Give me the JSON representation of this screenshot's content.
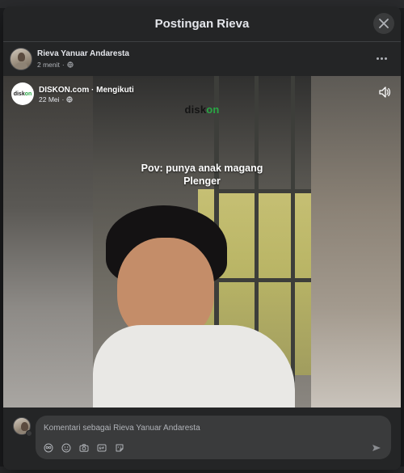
{
  "modal": {
    "title": "Postingan Rieva"
  },
  "post": {
    "author": "Rieva Yanuar Andaresta",
    "time": "2 menit",
    "separator": "·"
  },
  "video": {
    "page_name": "DISKON.com · Mengikuti",
    "page_logo_prefix": "disk",
    "page_logo_accent": "on",
    "date": "22 Mei",
    "separator": "·",
    "brand_prefix": "disk",
    "brand_accent": "on",
    "caption_line1": "Pov: punya anak magang",
    "caption_line2": "Plenger"
  },
  "comment": {
    "placeholder": "Komentari sebagai Rieva Yanuar Andaresta"
  },
  "icons": {
    "close": "close-icon",
    "more": "more-icon",
    "globe": "globe-icon",
    "volume": "volume-icon",
    "avatar_sticker": "avatar-sticker-icon",
    "emoji": "emoji-icon",
    "camera": "camera-icon",
    "gif": "gif-icon",
    "sticker": "sticker-icon",
    "send": "send-icon"
  },
  "colors": {
    "modal_bg": "#242526",
    "input_bg": "#3a3b3c",
    "text_primary": "#e4e6eb",
    "text_secondary": "#b0b3b8",
    "brand_green": "#29a745"
  }
}
